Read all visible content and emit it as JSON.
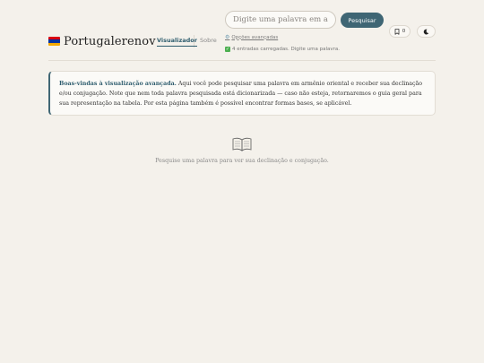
{
  "header": {
    "brand": "Portugalerenov",
    "flag_colors": [
      "#d90012",
      "#0033a0",
      "#f2a800"
    ],
    "nav": [
      {
        "label": "Visualizador",
        "active": true
      },
      {
        "label": "Sobre",
        "active": false
      }
    ],
    "search": {
      "placeholder": "Digite uma palavra em armênio",
      "value": "",
      "button_label": "Pesquisar"
    },
    "advanced_options": "Opções avançadas",
    "status": "4 entradas carregadas. Digite uma palavra.",
    "bookmark_count": "0"
  },
  "welcome": {
    "title": "Boas-vindas à visualização avançada.",
    "body": " Aqui você pode pesquisar uma palavra em armênio oriental e receber sua declinação e/ou conjugação. Note que nem toda palavra pesquisada está dicionarizada — caso não esteja, retornaremos o guia geral para sua representação na tabela. Por esta página também é possível encontrar formas bases, se aplicável."
  },
  "empty_state": {
    "icon": "book-icon",
    "text": "Pesquise uma palavra para ver sua declinação e conjugação."
  },
  "colors": {
    "accent": "#3f6674",
    "background": "#f4f1eb"
  }
}
